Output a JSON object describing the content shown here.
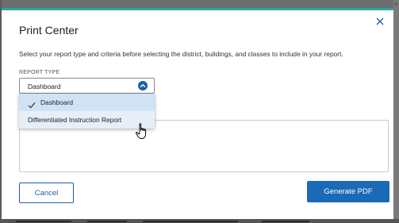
{
  "modal": {
    "title": "Print Center",
    "instructions": "Select your report type and criteria before selecting the district, buildings, and classes to include in your report.",
    "close_icon": "close-icon"
  },
  "report_type": {
    "label": "REPORT TYPE",
    "selected_value": "Dashboard",
    "options": [
      {
        "label": "Dashboard",
        "selected": true
      },
      {
        "label": "Differentiated Instruction Report",
        "selected": false,
        "hovered": true
      }
    ]
  },
  "actions": {
    "cancel_label": "Cancel",
    "generate_label": "Generate PDF"
  },
  "colors": {
    "accent_bar": "#2aa6a0",
    "primary": "#1b6ab8",
    "selected_option_bg": "#cfe2f6"
  },
  "icons": [
    "close-icon",
    "chevron-up-icon",
    "check-icon",
    "hand-pointer-icon"
  ]
}
